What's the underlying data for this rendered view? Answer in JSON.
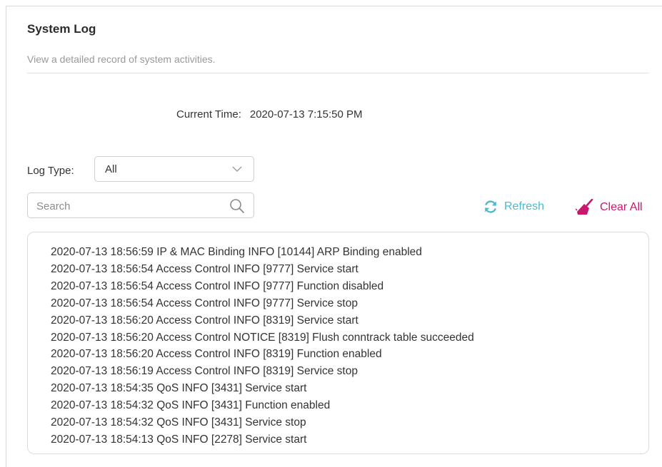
{
  "header": {
    "title": "System Log",
    "subtitle": "View a detailed record of system activities."
  },
  "current_time": {
    "label": "Current Time:",
    "value": "2020-07-13 7:15:50 PM"
  },
  "log_type": {
    "label": "Log Type:",
    "selected": "All",
    "icon": "chevron-down-icon"
  },
  "search": {
    "placeholder": "Search",
    "value": "",
    "icon": "search-icon"
  },
  "actions": {
    "refresh_label": "Refresh",
    "refresh_icon": "refresh-icon",
    "refresh_color": "#4fb8cf",
    "clear_label": "Clear All",
    "clear_icon": "broom-icon",
    "clear_color": "#c8186e"
  },
  "logs": [
    "2020-07-13 18:56:59 IP & MAC Binding INFO [10144] ARP Binding enabled",
    "2020-07-13 18:56:54 Access Control INFO [9777] Service start",
    "2020-07-13 18:56:54 Access Control INFO [9777] Function disabled",
    "2020-07-13 18:56:54 Access Control INFO [9777] Service stop",
    "2020-07-13 18:56:20 Access Control INFO [8319] Service start",
    "2020-07-13 18:56:20 Access Control NOTICE [8319] Flush conntrack table succeeded",
    "2020-07-13 18:56:20 Access Control INFO [8319] Function enabled",
    "2020-07-13 18:56:19 Access Control INFO [8319] Service stop",
    "2020-07-13 18:54:35 QoS INFO [3431] Service start",
    "2020-07-13 18:54:32 QoS INFO [3431] Function enabled",
    "2020-07-13 18:54:32 QoS INFO [3431] Service stop",
    "2020-07-13 18:54:13 QoS INFO [2278] Service start"
  ]
}
